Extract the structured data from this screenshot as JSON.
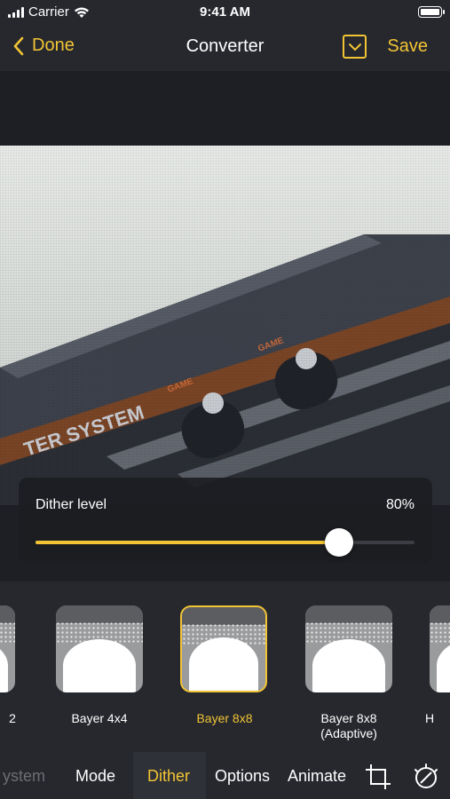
{
  "status_bar": {
    "carrier": "Carrier",
    "time": "9:41 AM"
  },
  "nav": {
    "back_label": "Done",
    "title": "Converter",
    "save_label": "Save"
  },
  "slider": {
    "label": "Dither level",
    "value_text": "80%",
    "value": 0.8
  },
  "presets": [
    {
      "name": "2",
      "selected": false
    },
    {
      "name": "Bayer 4x4",
      "selected": false
    },
    {
      "name": "Bayer 8x8",
      "selected": true
    },
    {
      "name": "Bayer 8x8\n(Adaptive)",
      "selected": false
    },
    {
      "name": "H",
      "selected": false
    }
  ],
  "tabs": [
    {
      "label": "ystem",
      "state": "faded"
    },
    {
      "label": "Mode",
      "state": "normal"
    },
    {
      "label": "Dither",
      "state": "active"
    },
    {
      "label": "Options",
      "state": "normal"
    },
    {
      "label": "Animate",
      "state": "normal"
    }
  ],
  "tab_icons": [
    "crop-icon",
    "adjust-icon"
  ],
  "colors": {
    "accent": "#f2c434",
    "bar_bg": "#26282e",
    "canvas_bg": "#1e1f24"
  }
}
